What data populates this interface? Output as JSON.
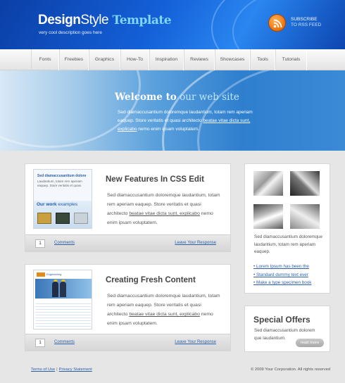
{
  "header": {
    "logo_bold": "Design",
    "logo_regular": "Style",
    "logo_accent": " Template",
    "tagline": "very cool description goes here",
    "subscribe_line1": "SUBSCRIBE",
    "subscribe_line2": "TO RSS FEED",
    "rss_icon": "rss-icon",
    "brand_color": "#1460d8"
  },
  "nav": {
    "items": [
      "Fonts",
      "Freebies",
      "Graphics",
      "How-To",
      "Inspiration",
      "Reviews",
      "Showcases",
      "Tools",
      "Tutorials"
    ]
  },
  "banner": {
    "title_bold": "Welcome to",
    "title_light": " our web site",
    "text_part1": "Sed diamaccusantium doloremque laudantium, totam rem aperiam eaquep. Store veritatis et quasi architecto ",
    "text_link": "beatae vitae dicta sunt, explicabo",
    "text_part2": " nemo enim ipsam voluptatem."
  },
  "posts": [
    {
      "title": "New Features In CSS Edit",
      "text_part1": "Sed diamaccusantium doloremque laudantium, totam rem aperiam eaquep. Store veritatis et quasi architecto ",
      "text_link": "beatae vitae dicta sunt, explicabo",
      "text_part2": " nemo enim ipsam voluptatem.",
      "thumb_title": "Sed diamaccusantium dolore",
      "thumb_text": "Laudantium, totam rem aperiam eaquep. Store veritatis et quasi.",
      "thumb_caption_bold": "Our work",
      "thumb_caption": " examples",
      "comment_count": "1",
      "comments_label": "Comments",
      "leave_label": "Leave Your Response"
    },
    {
      "title": "Creating Fresh Content",
      "text_part1": "Sed diamaccusantium doloremque laudantium, totam rem aperiam eaquep. Store veritatis et quasi architecto ",
      "text_link": "beatae vitae dicta sunt, explicabo",
      "text_part2": " nemo enim ipsam voluptatem.",
      "thumb_logo": "Engineering",
      "comment_count": "1",
      "comments_label": "Comments",
      "leave_label": "Leave Your Response"
    }
  ],
  "sidebar": {
    "text": "Sed diamaccusantium doloremque laudantium, totam rem aperiam eaquep.",
    "links": [
      "Lorem Ipsum has been the",
      "Standard dummy text ever",
      "Make a type specimen book"
    ]
  },
  "special": {
    "title": "Special Offers",
    "text": "Sed diamaccusantium dolorem que laudantium.",
    "button": "read more"
  },
  "footer": {
    "terms": "Terms of Use",
    "separator": "|",
    "privacy": "Privacy Statement",
    "copyright": "© 2009 Your Corporation. All rights reserved"
  }
}
